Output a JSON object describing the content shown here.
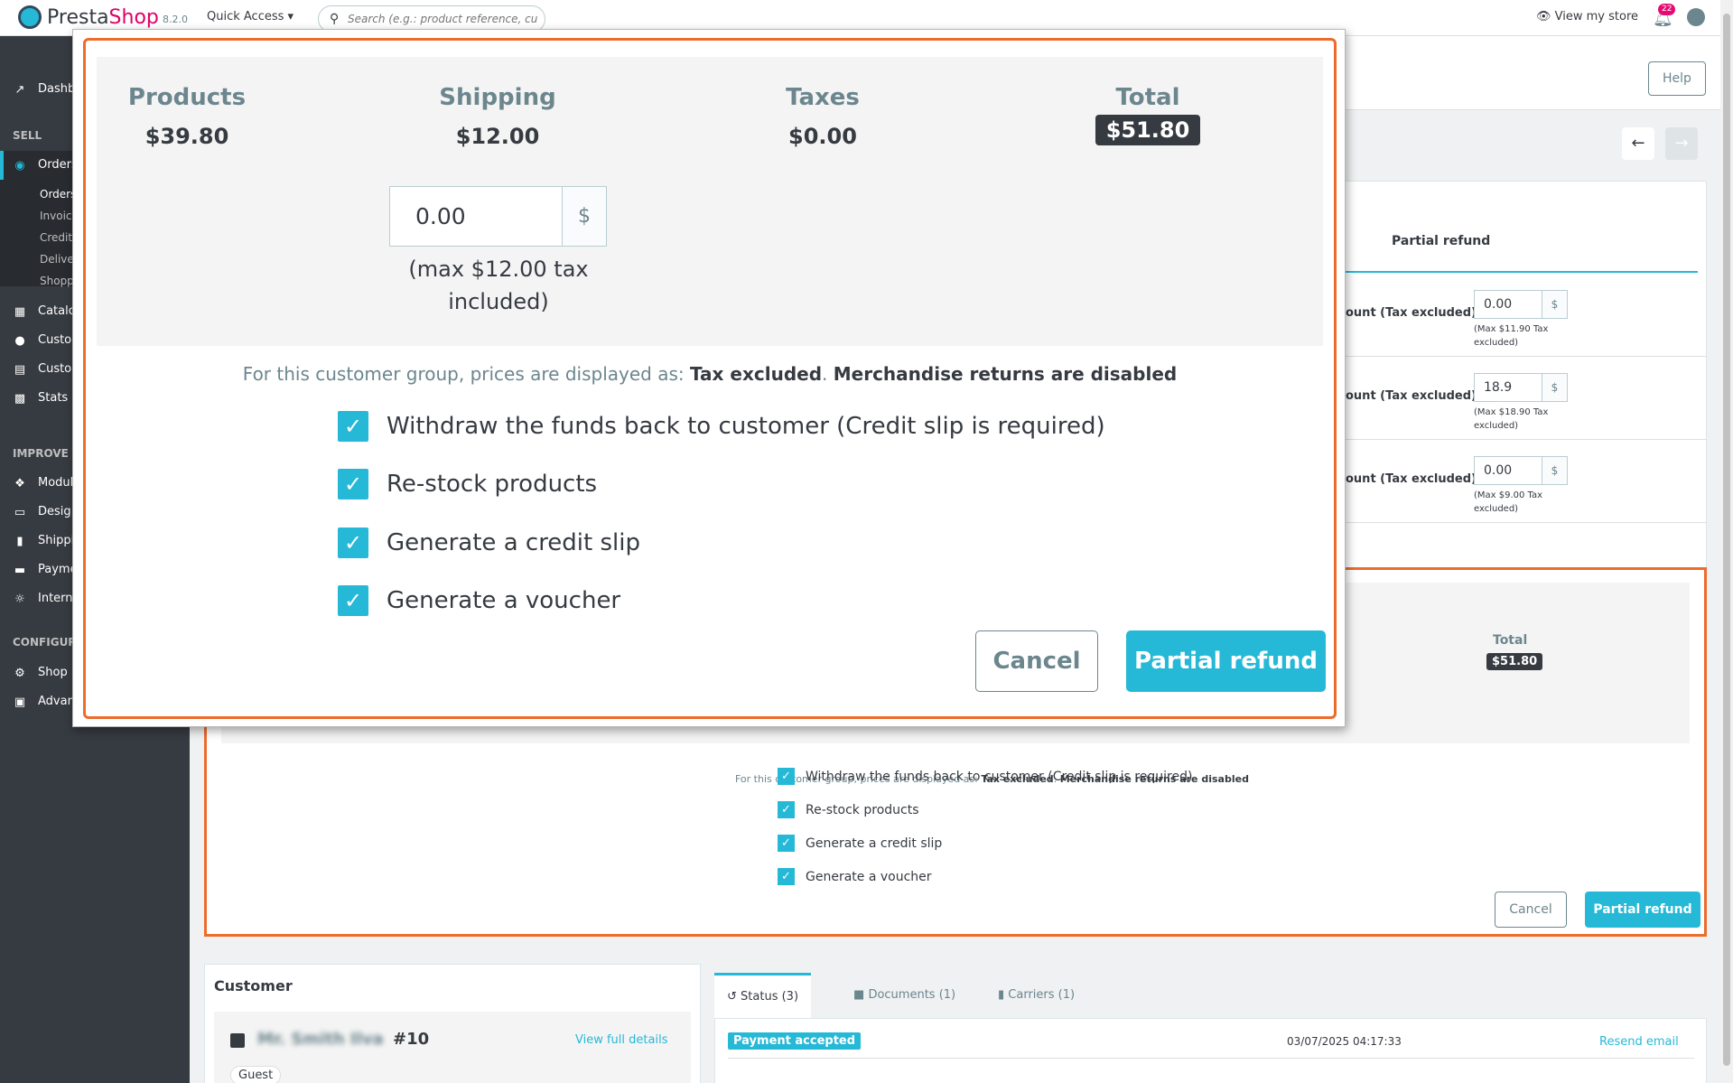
{
  "header": {
    "logo_presta": "Presta",
    "logo_shop": "Shop",
    "version": "8.2.0",
    "quick_access": "Quick Access ▾",
    "search_placeholder": "Search (e.g.: product reference, custon",
    "view_store": "View my store",
    "notifications_count": "22"
  },
  "sidebar": {
    "dashboard": "Dashb",
    "section_sell": "SELL",
    "orders": "Orders",
    "orders_sub": [
      "Orders",
      "Invoic",
      "Credit",
      "Delive",
      "Shopp"
    ],
    "catalog": "Catalo",
    "customers": "Custo",
    "customer_service": "Custo",
    "stats": "Stats",
    "section_improve": "IMPROVE",
    "modules": "Modul",
    "design": "Desig",
    "shipping": "Shippi",
    "payment": "Payme",
    "international": "Intern",
    "section_configure": "CONFIGUR",
    "shop_params": "Shop I",
    "advanced": "Advan"
  },
  "toolbar": {
    "help": "Help"
  },
  "background": {
    "tab_partial_refund": "Partial refund",
    "refund_rows": [
      {
        "label": "ount (Tax excluded)",
        "value": "0.00",
        "currency": "$",
        "max": "(Max $11.90 Tax excluded)"
      },
      {
        "label": "ount (Tax excluded)",
        "value": "18.9",
        "currency": "$",
        "max": "(Max $18.90 Tax excluded)"
      },
      {
        "label": "ount (Tax excluded)",
        "value": "0.00",
        "currency": "$",
        "max": "(Max $9.00 Tax excluded)"
      }
    ],
    "total_label": "Total",
    "total_value": "$51.80",
    "note_prefix": "For this customer group, prices are displayed as: ",
    "note_tax": "Tax excluded",
    "note_sep": ". ",
    "note_returns": "Merchandise returns are disabled",
    "checks": [
      "Withdraw the funds back to customer (Credit slip is required)",
      "Re-stock products",
      "Generate a credit slip",
      "Generate a voucher"
    ],
    "cancel": "Cancel",
    "partial_refund": "Partial refund"
  },
  "customer": {
    "title": "Customer",
    "name": "Mr. Smith Ilva",
    "id": "#10",
    "view_full": "View full details",
    "guest": "Guest"
  },
  "status": {
    "tabs": [
      "Status (3)",
      "Documents (1)",
      "Carriers (1)"
    ],
    "rows": [
      {
        "badge": "Payment accepted",
        "date": "03/07/2025 04:17:33",
        "action": "Resend email"
      }
    ]
  },
  "zoom": {
    "products_label": "Products",
    "products_value": "$39.80",
    "shipping_label": "Shipping",
    "shipping_value": "$12.00",
    "shipping_input": "0.00",
    "shipping_currency": "$",
    "shipping_max": "(max $12.00 tax included)",
    "taxes_label": "Taxes",
    "taxes_value": "$0.00",
    "total_label": "Total",
    "total_value": "$51.80",
    "note_prefix": "For this customer group, prices are displayed as: ",
    "note_tax": "Tax excluded",
    "note_sep": ". ",
    "note_returns": "Merchandise returns are disabled",
    "checks": [
      "Withdraw the funds back to customer (Credit slip is required)",
      "Re-stock products",
      "Generate a credit slip",
      "Generate a voucher"
    ],
    "cancel": "Cancel",
    "partial_refund": "Partial refund"
  },
  "colors": {
    "accent": "#25b9d7",
    "highlight": "#ed6c2b",
    "sidebar": "#363a41"
  }
}
